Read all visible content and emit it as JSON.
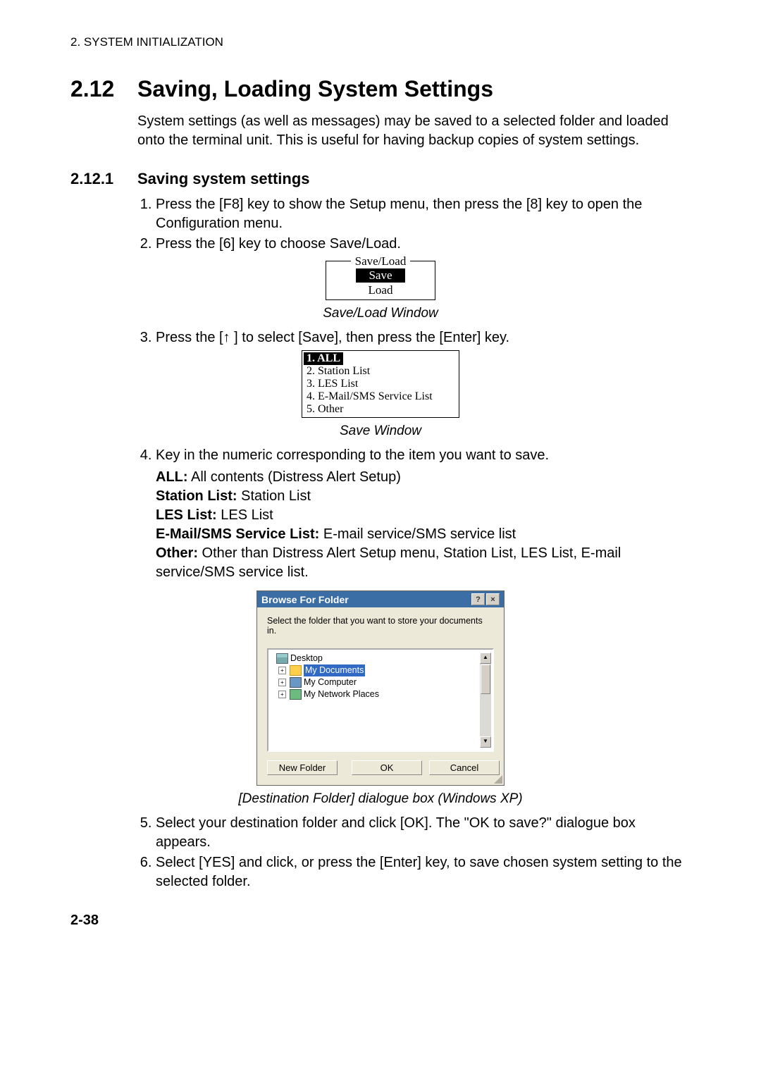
{
  "header": "2. SYSTEM INITIALIZATION",
  "section": {
    "number": "2.12",
    "title": "Saving, Loading System Settings",
    "intro": "System settings (as well as messages) may be saved to a selected folder and loaded onto the terminal unit. This is useful for having backup copies of system settings."
  },
  "subsection": {
    "number": "2.12.1",
    "title": "Saving system settings"
  },
  "steps": {
    "1": "Press the [F8] key to show the Setup menu, then press the [8] key to open the Configuration menu.",
    "2": "Press the [6] key to choose Save/Load.",
    "3": "Press the [↑ ]  to select [Save], then press the [Enter] key.",
    "4": "Key in the numeric corresponding to the item you want to save.",
    "5": "Select your destination folder and click [OK].    The \"OK to save?\" dialogue box appears.",
    "6": "Select [YES] and click, or press the [Enter] key, to save chosen system setting to the selected folder."
  },
  "saveload_window": {
    "legend": "Save/Load",
    "item_save": "Save",
    "item_load": "Load",
    "caption": "Save/Load Window"
  },
  "save_window": {
    "items": {
      "1": "1. ALL",
      "2": "2. Station List",
      "3": "3. LES List",
      "4": "4. E-Mail/SMS Service List",
      "5": "5. Other"
    },
    "caption": "Save Window"
  },
  "desc": {
    "all_name": "ALL:",
    "all_text": " All contents (Distress Alert Setup)",
    "station_name": "Station List:",
    "station_text": " Station List",
    "les_name": "LES List:",
    "les_text": " LES List",
    "email_name": "E-Mail/SMS Service List:",
    "email_text": " E-mail service/SMS service list",
    "other_name": "Other:",
    "other_text": " Other than Distress Alert Setup menu, Station List, LES List, E-mail service/SMS service list."
  },
  "browse": {
    "title": "Browse For Folder",
    "help_icon": "?",
    "close_icon": "×",
    "instruction": "Select the folder that you want to store your documents in.",
    "tree": {
      "desktop": "Desktop",
      "mydocs": "My Documents",
      "mycomp": "My Computer",
      "myneigh": "My Network Places"
    },
    "scroll_up": "▲",
    "scroll_down": "▼",
    "btn_newfolder": "New Folder",
    "btn_ok": "OK",
    "btn_cancel": "Cancel",
    "caption": "[Destination Folder] dialogue box (Windows XP)"
  },
  "pagenum": "2-38"
}
